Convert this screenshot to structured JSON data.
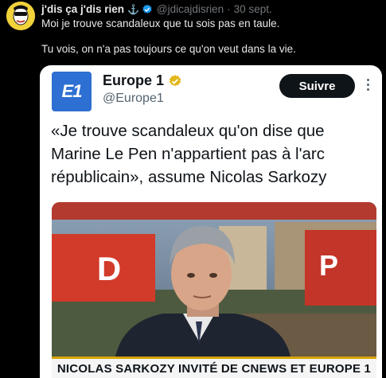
{
  "tweet": {
    "author_name": "j'dis ça j'dis rien",
    "author_handle": "@jdicajdisrien",
    "separator": "·",
    "timestamp": "30 sept.",
    "lines": [
      "Moi je trouve scandaleux que tu sois pas en taule.",
      "Tu vois, on n'a pas toujours ce qu'on veut dans la vie."
    ]
  },
  "quoted": {
    "logo_text": "E1",
    "name": "Europe 1",
    "handle": "@Europe1",
    "follow_label": "Suivre",
    "title": "«Je trouve scandaleux qu'on dise que Marine Le Pen n'appartient pas à l'arc républicain», assume Nicolas Sarkozy",
    "media": {
      "caption": "NICOLAS SARKOZY INVITÉ DE CNEWS ET EUROPE 1",
      "sign_left": "D",
      "sign_right": "P"
    }
  },
  "colors": {
    "background": "#000000",
    "text_primary": "#e7e9ea",
    "text_muted": "#71767b",
    "verified_blue": "#1d9bf0",
    "verified_gold": "#e2b719",
    "europe1_blue": "#2d6fd2",
    "follow_button": "#0f1419"
  },
  "icons": {
    "verified": "verified-badge-icon",
    "gold": "gold-verified-badge-icon",
    "more": "more-options-icon"
  }
}
